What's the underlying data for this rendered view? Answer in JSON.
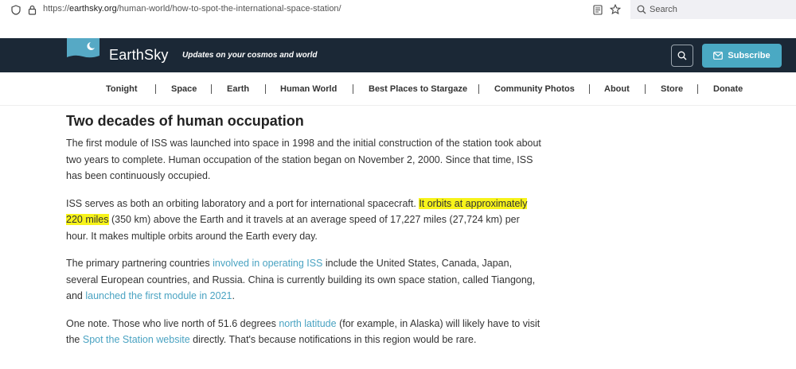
{
  "browser": {
    "url_prefix": "https://",
    "url_domain": "earthsky.org",
    "url_path": "/human-world/how-to-spot-the-international-space-station/",
    "search_placeholder": "Search"
  },
  "header": {
    "brand": "EarthSky",
    "tagline": "Updates on your cosmos and world",
    "subscribe_label": "Subscribe",
    "bg_color": "#1b2836",
    "accent_color": "#4aa9c3"
  },
  "nav": {
    "items": [
      {
        "label": "Tonight"
      },
      {
        "label": "Space"
      },
      {
        "label": "Earth"
      },
      {
        "label": "Human World"
      },
      {
        "label": "Best Places to Stargaze"
      },
      {
        "label": "Community Photos"
      },
      {
        "label": "About"
      },
      {
        "label": "Store"
      },
      {
        "label": "Donate"
      }
    ]
  },
  "article": {
    "heading": "Two decades of human occupation",
    "p1": "The first module of ISS was launched into space in 1998 and the initial construction of the station took about two years to complete. Human occupation of the station began on November 2, 2000. Since that time, ISS has been continuously occupied.",
    "p2_a": "ISS serves as both an orbiting laboratory and a port for international spacecraft. ",
    "p2_highlight": "It orbits at approximately 220 miles",
    "p2_b": " (350 km) above the Earth and it travels at an average speed of 17,227 miles (27,724 km) per hour. It makes multiple orbits around the Earth every day.",
    "p3_a": "The primary partnering countries ",
    "p3_link1": "involved in operating ISS",
    "p3_b": " include the United States, Canada, Japan, several European countries, and Russia. China is currently building its own space station, called Tiangong, and ",
    "p3_link2": "launched the first module in 2021",
    "p3_c": ".",
    "p4_a": "One note. Those who live north of 51.6 degrees ",
    "p4_link1": "north latitude",
    "p4_b": " (for example, in Alaska) will likely have to visit the ",
    "p4_link2": "Spot the Station website",
    "p4_c": " directly. That's because notifications in this region would be rare.",
    "link_color": "#4aa3c2",
    "highlight_color": "#f7f31a"
  },
  "icons": {
    "shield": "shield-icon",
    "lock": "lock-icon",
    "reader": "reader-view-icon",
    "star": "bookmark-star-icon",
    "search": "search-icon",
    "mail": "mail-icon"
  }
}
